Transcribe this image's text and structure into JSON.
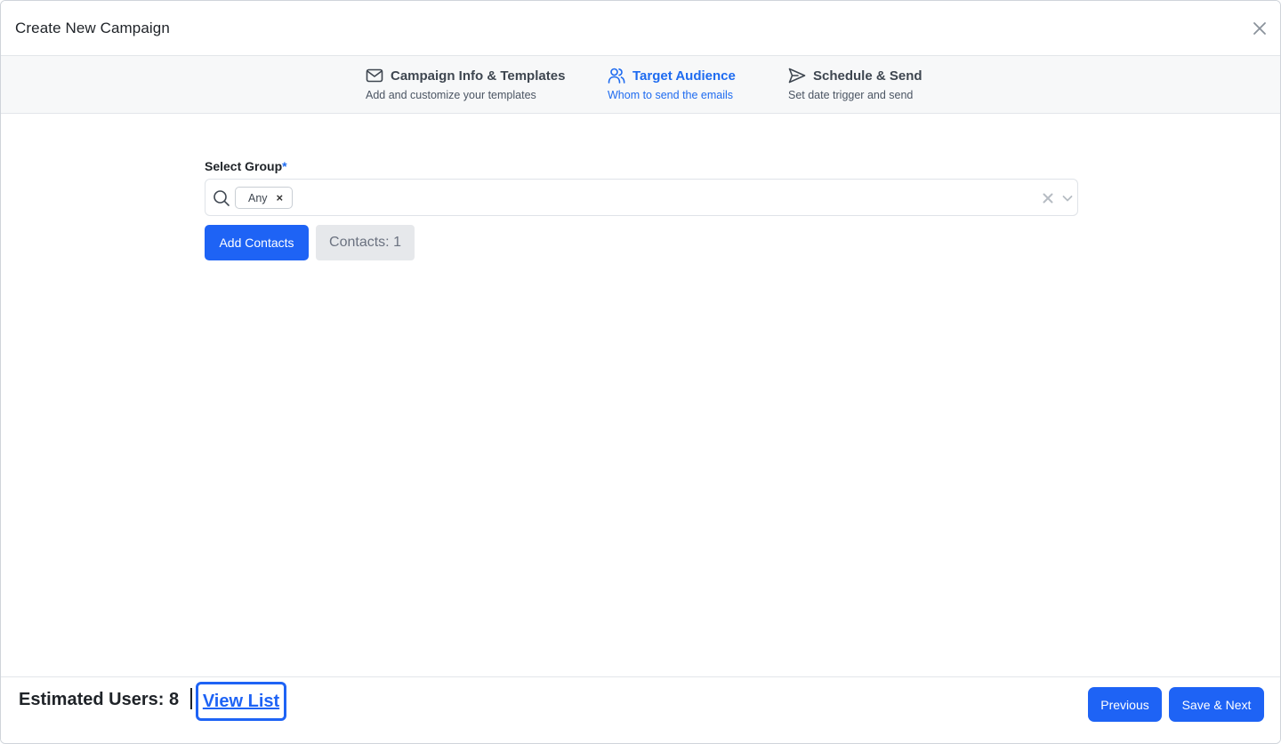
{
  "modal": {
    "title": "Create New Campaign"
  },
  "stepper": {
    "steps": [
      {
        "title": "Campaign Info & Templates",
        "subtitle": "Add and customize your templates",
        "icon": "mail-icon",
        "active": false
      },
      {
        "title": "Target Audience",
        "subtitle": "Whom to send the emails",
        "icon": "users-icon",
        "active": true
      },
      {
        "title": "Schedule & Send",
        "subtitle": "Set date trigger and send",
        "icon": "send-icon",
        "active": false
      }
    ]
  },
  "form": {
    "group_label": "Select Group",
    "required_mark": "*",
    "selected_tags": [
      "Any"
    ],
    "tag_remove_glyph": "×",
    "add_contacts_label": "Add Contacts",
    "contacts_count_label": "Contacts: 1"
  },
  "footer": {
    "estimated_users": "Estimated Users: 8",
    "view_list_label": "View List",
    "previous_label": "Previous",
    "next_label": "Save & Next"
  },
  "colors": {
    "accent": "#1e63f5",
    "active_step": "#1e6bf0",
    "stepper_bg": "#f7f8f9",
    "muted_button_bg": "#e6e8eb"
  }
}
